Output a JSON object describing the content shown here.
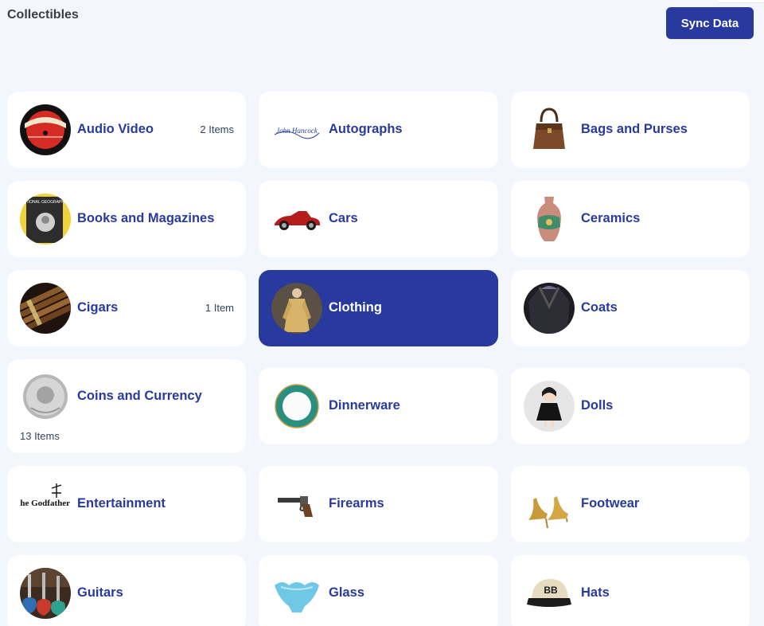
{
  "header": {
    "title": "Collectibles",
    "sync_label": "Sync Data"
  },
  "colors": {
    "page_bg": "#f3f6fd",
    "accent": "#283a9e",
    "card_bg": "#ffffff"
  },
  "categories": [
    {
      "label": "Audio Video",
      "count": "2 Items",
      "icon": "vinyl-record-icon"
    },
    {
      "label": "Autographs",
      "count": "",
      "icon": "signature-icon",
      "signature_text": "John Hancock"
    },
    {
      "label": "Bags and Purses",
      "count": "",
      "icon": "handbag-icon"
    },
    {
      "label": "Books and Magazines",
      "count": "",
      "icon": "magazine-icon",
      "magazine_text": "NATIONAL GEOGRAPHIC"
    },
    {
      "label": "Cars",
      "count": "",
      "icon": "car-icon"
    },
    {
      "label": "Ceramics",
      "count": "",
      "icon": "vase-icon"
    },
    {
      "label": "Cigars",
      "count": "1 Item",
      "icon": "cigar-icon"
    },
    {
      "label": "Clothing",
      "count": "",
      "icon": "clothing-icon",
      "selected": true
    },
    {
      "label": "Coats",
      "count": "",
      "icon": "coat-icon"
    },
    {
      "label": "Coins and Currency",
      "count": "13 Items",
      "icon": "coin-icon"
    },
    {
      "label": "Dinnerware",
      "count": "",
      "icon": "plate-icon"
    },
    {
      "label": "Dolls",
      "count": "",
      "icon": "doll-icon"
    },
    {
      "label": "Entertainment",
      "count": "",
      "icon": "movie-poster-icon",
      "poster_text": "The Godfather"
    },
    {
      "label": "Firearms",
      "count": "",
      "icon": "revolver-icon"
    },
    {
      "label": "Footwear",
      "count": "",
      "icon": "high-heels-icon"
    },
    {
      "label": "Guitars",
      "count": "",
      "icon": "guitar-icon"
    },
    {
      "label": "Glass",
      "count": "",
      "icon": "glass-bowl-icon"
    },
    {
      "label": "Hats",
      "count": "",
      "icon": "baseball-cap-icon",
      "cap_text": "BB"
    }
  ]
}
